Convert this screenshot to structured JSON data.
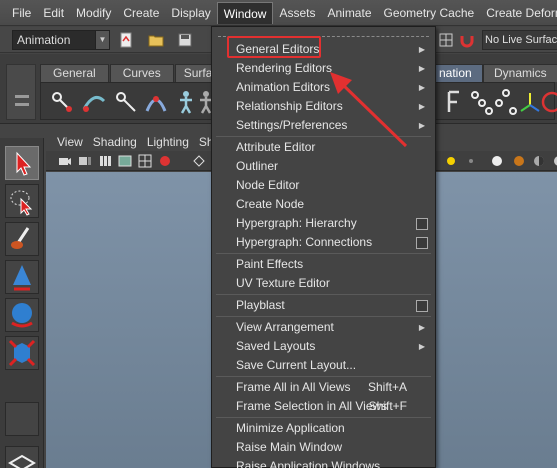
{
  "menubar": {
    "items": [
      "File",
      "Edit",
      "Modify",
      "Create",
      "Display",
      "Window",
      "Assets",
      "Animate",
      "Geometry Cache",
      "Create Deformers"
    ],
    "active": "Window"
  },
  "statusline": {
    "mode": "Animation",
    "live_surface": "No Live Surface"
  },
  "shelf": {
    "tabs": [
      "General",
      "Curves",
      "Surfac"
    ],
    "right_tabs": [
      "nation",
      "Dynamics"
    ]
  },
  "panel": {
    "menu": [
      "View",
      "Shading",
      "Lighting",
      "Sho"
    ]
  },
  "window_menu": {
    "items": [
      {
        "label": "General Editors",
        "submenu": true
      },
      {
        "label": "Rendering Editors",
        "submenu": true
      },
      {
        "label": "Animation Editors",
        "submenu": true
      },
      {
        "label": "Relationship Editors",
        "submenu": true
      },
      {
        "label": "Settings/Preferences",
        "submenu": true
      },
      {
        "label": "Attribute Editor"
      },
      {
        "label": "Outliner"
      },
      {
        "label": "Node Editor"
      },
      {
        "label": "Create Node"
      },
      {
        "label": "Hypergraph: Hierarchy",
        "option_box": true
      },
      {
        "label": "Hypergraph: Connections",
        "option_box": true
      },
      {
        "label": "Paint Effects"
      },
      {
        "label": "UV Texture Editor"
      },
      {
        "label": "Playblast",
        "option_box": true
      },
      {
        "label": "View Arrangement",
        "submenu": true
      },
      {
        "label": "Saved Layouts",
        "submenu": true
      },
      {
        "label": "Save Current Layout..."
      },
      {
        "label": "Frame All in All Views",
        "shortcut": "Shift+A"
      },
      {
        "label": "Frame Selection in All Views",
        "shortcut": "Shift+F"
      },
      {
        "label": "Minimize Application"
      },
      {
        "label": "Raise Main Window"
      },
      {
        "label": "Raise Application Windows"
      }
    ]
  },
  "annotation": {
    "color": "#e23030"
  }
}
